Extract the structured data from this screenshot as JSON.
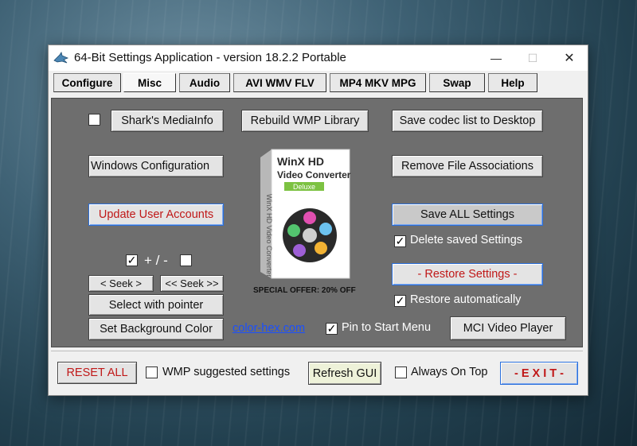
{
  "window": {
    "title": "64-Bit Settings Application - version 18.2.2 Portable",
    "minimize_glyph": "—",
    "maximize_glyph": "☐",
    "close_glyph": "✕"
  },
  "tabs": [
    {
      "label": "Configure"
    },
    {
      "label": "Misc"
    },
    {
      "label": "Audio"
    },
    {
      "label": "AVI WMV FLV"
    },
    {
      "label": "MP4 MKV MPG"
    },
    {
      "label": "Swap"
    },
    {
      "label": "Help"
    }
  ],
  "active_tab": "Misc",
  "misc": {
    "shark_mediainfo": "Shark's MediaInfo",
    "rebuild_wmp": "Rebuild WMP Library",
    "save_codec_list": "Save codec list to Desktop",
    "windows_config": "Windows Configuration",
    "remove_file_assoc": "Remove File Associations",
    "update_user_accounts": "Update User Accounts",
    "save_all_settings": "Save ALL Settings",
    "delete_saved_settings": "Delete saved Settings",
    "plus_minus": "+ / -",
    "seek_forward": "< Seek >",
    "seek_back": "<< Seek >>",
    "restore_settings": "- Restore Settings -",
    "select_with_pointer": "Select with pointer",
    "restore_auto": "Restore automatically",
    "set_bg_color": "Set Background Color",
    "color_hex_link": "color-hex.com",
    "pin_start_menu": "Pin to Start Menu",
    "mci_video_player": "MCI Video Player",
    "promo_offer": "SPECIAL OFFER: 20% OFF",
    "promo_box": {
      "line1": "WinX HD",
      "line2": "Video Converter",
      "badge": "Deluxe",
      "spine": "WinX HD Video Converter"
    }
  },
  "checkboxes": {
    "shark": false,
    "plus": true,
    "minus": false,
    "delete_saved": true,
    "restore_auto": true,
    "pin_start": true,
    "wmp_suggested": false,
    "always_on_top": false
  },
  "check_glyph": "✓",
  "bottom": {
    "reset_all": "RESET ALL",
    "wmp_suggested": "WMP suggested settings",
    "refresh_gui": "Refresh GUI",
    "always_on_top": "Always On Top",
    "exit": "- E X I T -"
  },
  "colors": {
    "panel": "#6e6e6e",
    "accent_blue": "#2a6fdb",
    "red": "#c01818",
    "link": "#1a4fff"
  }
}
